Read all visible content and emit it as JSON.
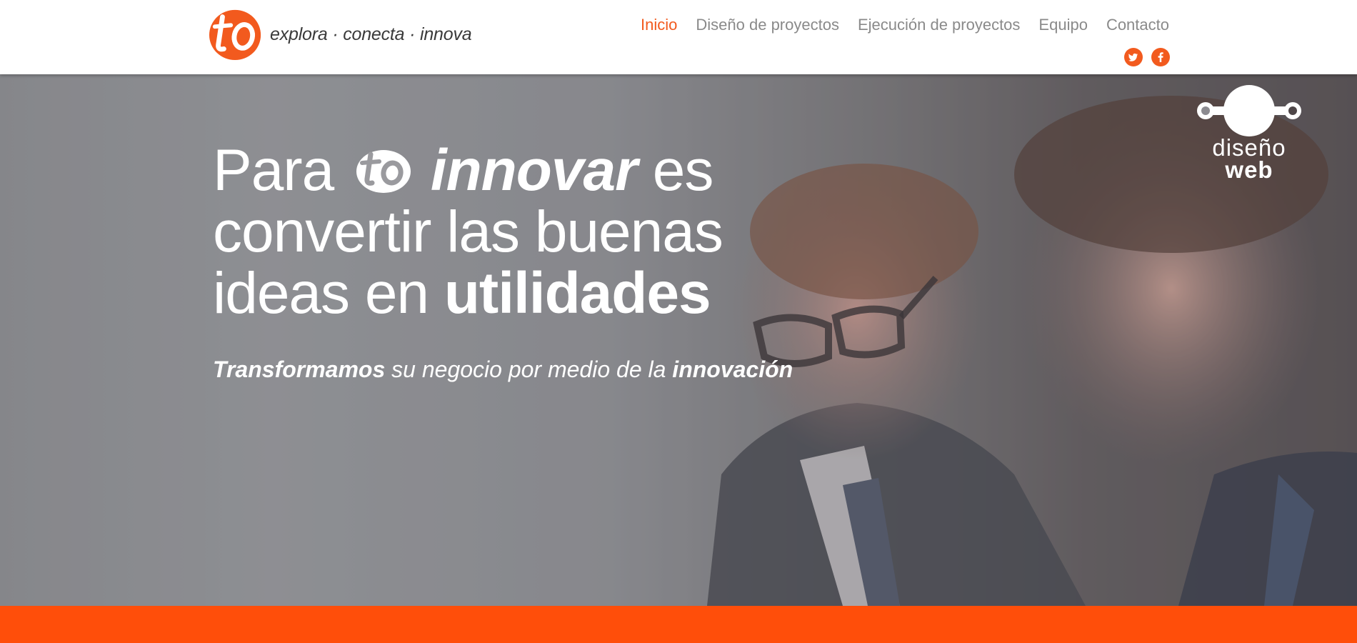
{
  "brand": {
    "logo_text": "to",
    "tagline": "explora · conecta · innova",
    "accent_color": "#f25a1e"
  },
  "nav": {
    "items": [
      {
        "label": "Inicio",
        "active": true
      },
      {
        "label": "Diseño de proyectos",
        "active": false
      },
      {
        "label": "Ejecución de proyectos",
        "active": false
      },
      {
        "label": "Equipo",
        "active": false
      },
      {
        "label": "Contacto",
        "active": false
      }
    ]
  },
  "social": {
    "twitter_icon": "twitter-icon",
    "facebook_icon": "facebook-icon"
  },
  "hero": {
    "headline": {
      "part1": "Para",
      "part2": "innovar",
      "part3": "es",
      "line2": "convertir las buenas",
      "line3_a": "ideas en",
      "line3_b": "utilidades"
    },
    "subline": {
      "bold_start": "Transformamos",
      "middle": "su negocio por medio de la",
      "bold_end": "innovación"
    },
    "badge": {
      "line1": "diseño",
      "line2": "web"
    }
  },
  "footer_bar_color": "#ff4e0a"
}
